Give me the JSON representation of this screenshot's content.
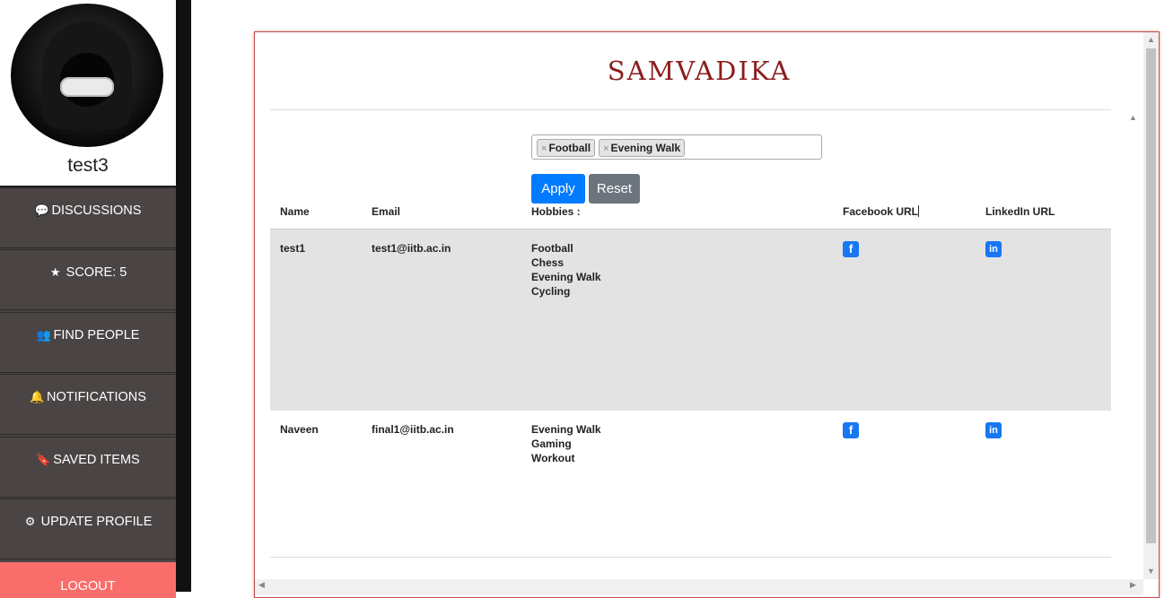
{
  "sidebar": {
    "username": "test3",
    "items": [
      {
        "icon": "comment-icon",
        "glyph": "💬",
        "label": "DISCUSSIONS"
      },
      {
        "icon": "star-icon",
        "glyph": "★",
        "label": "SCORE: 5"
      },
      {
        "icon": "users-icon",
        "glyph": "👥",
        "label": "FIND PEOPLE"
      },
      {
        "icon": "bell-icon",
        "glyph": "🔔",
        "label": "NOTIFICATIONS"
      },
      {
        "icon": "bookmark-icon",
        "glyph": "🔖",
        "label": "SAVED ITEMS"
      },
      {
        "icon": "gear-icon",
        "glyph": "⚙",
        "label": "UPDATE PROFILE"
      }
    ],
    "logout_label": "LOGOUT"
  },
  "main": {
    "title": "SAMVADIKA",
    "filter_tags": [
      "Football",
      "Evening Walk"
    ],
    "apply_label": "Apply",
    "reset_label": "Reset",
    "columns": [
      "Name",
      "Email",
      "Hobbies :",
      "Facebook URL",
      "LinkedIn URL"
    ],
    "rows": [
      {
        "name": "test1",
        "email": "test1@iitb.ac.in",
        "hobbies": [
          "Football",
          "Chess",
          "Evening Walk",
          "Cycling"
        ]
      },
      {
        "name": "Naveen",
        "email": "final1@iitb.ac.in",
        "hobbies": [
          "Evening Walk",
          "Gaming",
          "Workout"
        ]
      }
    ]
  },
  "colors": {
    "accent": "#007bff",
    "title": "#8b1d1d",
    "logout": "#f96d6a",
    "sidebar": "#4a4544"
  }
}
